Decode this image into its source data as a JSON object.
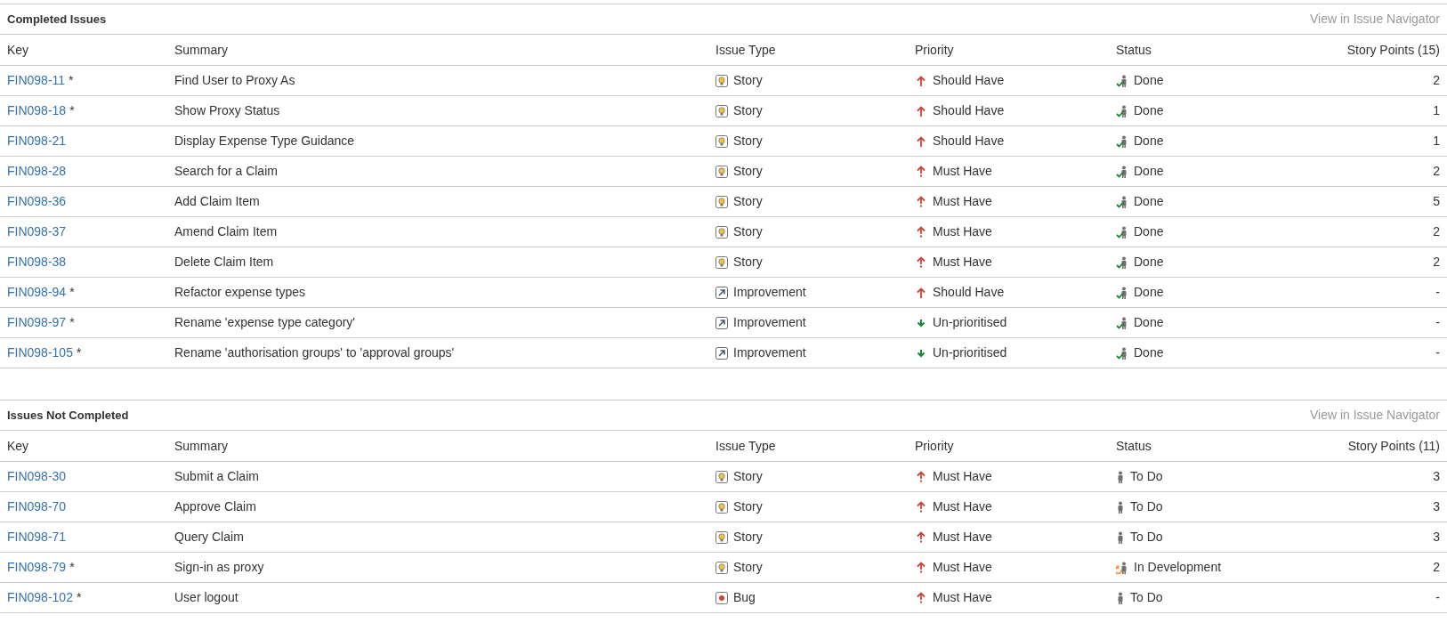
{
  "sections": [
    {
      "title": "Completed Issues",
      "link": "View in Issue Navigator",
      "columns": [
        "Key",
        "Summary",
        "Issue Type",
        "Priority",
        "Status",
        "Story Points (15)"
      ],
      "rows": [
        {
          "key": "FIN098-11",
          "marker": "*",
          "summary": "Find User to Proxy As",
          "type": {
            "kind": "story",
            "label": "Story"
          },
          "priority": {
            "kind": "should",
            "label": "Should Have"
          },
          "status": {
            "kind": "done",
            "label": "Done"
          },
          "points": "2"
        },
        {
          "key": "FIN098-18",
          "marker": "*",
          "summary": "Show Proxy Status",
          "type": {
            "kind": "story",
            "label": "Story"
          },
          "priority": {
            "kind": "should",
            "label": "Should Have"
          },
          "status": {
            "kind": "done",
            "label": "Done"
          },
          "points": "1"
        },
        {
          "key": "FIN098-21",
          "summary": "Display Expense Type Guidance",
          "type": {
            "kind": "story",
            "label": "Story"
          },
          "priority": {
            "kind": "should",
            "label": "Should Have"
          },
          "status": {
            "kind": "done",
            "label": "Done"
          },
          "points": "1"
        },
        {
          "key": "FIN098-28",
          "summary": "Search for a Claim",
          "type": {
            "kind": "story",
            "label": "Story"
          },
          "priority": {
            "kind": "must",
            "label": "Must Have"
          },
          "status": {
            "kind": "done",
            "label": "Done"
          },
          "points": "2"
        },
        {
          "key": "FIN098-36",
          "summary": "Add Claim Item",
          "type": {
            "kind": "story",
            "label": "Story"
          },
          "priority": {
            "kind": "must",
            "label": "Must Have"
          },
          "status": {
            "kind": "done",
            "label": "Done"
          },
          "points": "5"
        },
        {
          "key": "FIN098-37",
          "summary": "Amend Claim Item",
          "type": {
            "kind": "story",
            "label": "Story"
          },
          "priority": {
            "kind": "must",
            "label": "Must Have"
          },
          "status": {
            "kind": "done",
            "label": "Done"
          },
          "points": "2"
        },
        {
          "key": "FIN098-38",
          "summary": "Delete Claim Item",
          "type": {
            "kind": "story",
            "label": "Story"
          },
          "priority": {
            "kind": "must",
            "label": "Must Have"
          },
          "status": {
            "kind": "done",
            "label": "Done"
          },
          "points": "2"
        },
        {
          "key": "FIN098-94",
          "marker": "*",
          "summary": "Refactor expense types",
          "type": {
            "kind": "improvement",
            "label": "Improvement"
          },
          "priority": {
            "kind": "should",
            "label": "Should Have"
          },
          "status": {
            "kind": "done",
            "label": "Done"
          },
          "points": "-"
        },
        {
          "key": "FIN098-97",
          "marker": "*",
          "summary": "Rename 'expense type category'",
          "type": {
            "kind": "improvement",
            "label": "Improvement"
          },
          "priority": {
            "kind": "low",
            "label": "Un-prioritised"
          },
          "status": {
            "kind": "done",
            "label": "Done"
          },
          "points": "-"
        },
        {
          "key": "FIN098-105",
          "marker": "*",
          "summary": "Rename 'authorisation groups' to 'approval groups'",
          "type": {
            "kind": "improvement",
            "label": "Improvement"
          },
          "priority": {
            "kind": "low",
            "label": "Un-prioritised"
          },
          "status": {
            "kind": "done",
            "label": "Done"
          },
          "points": "-"
        }
      ]
    },
    {
      "title": "Issues Not Completed",
      "link": "View in Issue Navigator",
      "columns": [
        "Key",
        "Summary",
        "Issue Type",
        "Priority",
        "Status",
        "Story Points (11)"
      ],
      "rows": [
        {
          "key": "FIN098-30",
          "summary": "Submit a Claim",
          "type": {
            "kind": "story",
            "label": "Story"
          },
          "priority": {
            "kind": "must",
            "label": "Must Have"
          },
          "status": {
            "kind": "todo",
            "label": "To Do"
          },
          "points": "3"
        },
        {
          "key": "FIN098-70",
          "summary": "Approve Claim",
          "type": {
            "kind": "story",
            "label": "Story"
          },
          "priority": {
            "kind": "must",
            "label": "Must Have"
          },
          "status": {
            "kind": "todo",
            "label": "To Do"
          },
          "points": "3"
        },
        {
          "key": "FIN098-71",
          "summary": "Query Claim",
          "type": {
            "kind": "story",
            "label": "Story"
          },
          "priority": {
            "kind": "must",
            "label": "Must Have"
          },
          "status": {
            "kind": "todo",
            "label": "To Do"
          },
          "points": "3"
        },
        {
          "key": "FIN098-79",
          "marker": "*",
          "summary": "Sign-in as proxy",
          "type": {
            "kind": "story",
            "label": "Story"
          },
          "priority": {
            "kind": "must",
            "label": "Must Have"
          },
          "status": {
            "kind": "inprogress",
            "label": "In Development"
          },
          "points": "2"
        },
        {
          "key": "FIN098-102",
          "marker": "*",
          "summary": "User logout",
          "type": {
            "kind": "bug",
            "label": "Bug"
          },
          "priority": {
            "kind": "must",
            "label": "Must Have"
          },
          "status": {
            "kind": "todo",
            "label": "To Do"
          },
          "points": "-"
        }
      ]
    }
  ]
}
